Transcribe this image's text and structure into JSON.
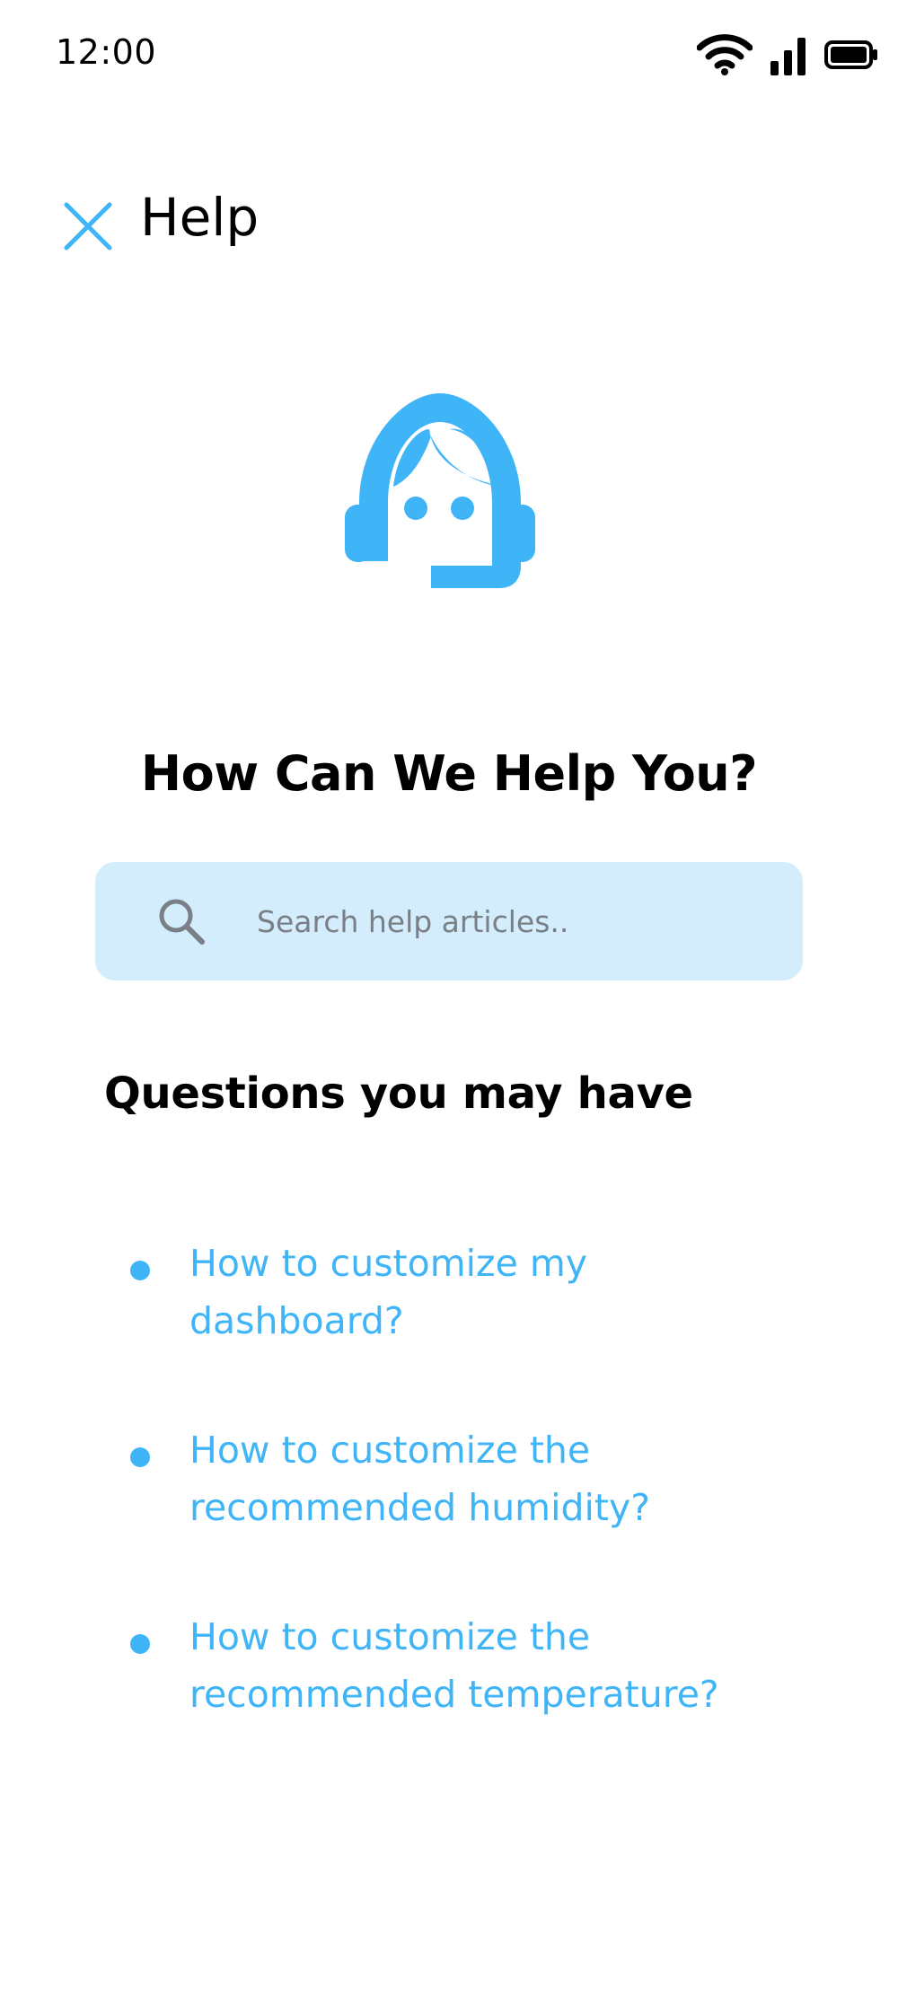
{
  "status_bar": {
    "time": "12:00",
    "icons": [
      "wifi-icon",
      "cellular-signal-icon",
      "battery-icon"
    ]
  },
  "header": {
    "title": "Help",
    "close_icon": "close-icon"
  },
  "illustration": {
    "icon": "support-agent-icon"
  },
  "main": {
    "title": "How Can We Help You?",
    "search": {
      "placeholder": "Search help articles..",
      "value": "",
      "icon": "search-icon"
    },
    "questions_title": "Questions you may have",
    "questions": [
      {
        "line1": "How to customize my",
        "line2": "dashboard?"
      },
      {
        "line1": "How to customize the",
        "line2": "recommended humidity?"
      },
      {
        "line1": "How to customize the",
        "line2": "recommended temperature?"
      }
    ]
  },
  "colors": {
    "accent": "#3fb4f7",
    "search_background": "#d3edfc",
    "text_primary": "#000000",
    "placeholder": "#7a7f85"
  }
}
